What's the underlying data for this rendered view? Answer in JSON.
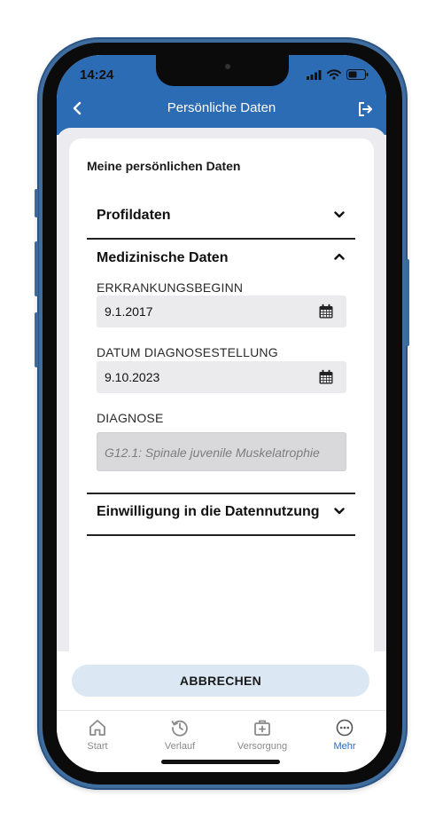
{
  "status_bar": {
    "time": "14:24"
  },
  "nav": {
    "title": "Persönliche Daten"
  },
  "card": {
    "title": "Meine persönlichen Daten"
  },
  "sections": {
    "profile": {
      "label": "Profildaten"
    },
    "medical": {
      "label": "Medizinische Daten",
      "onset_label": "ERKRANKUNGSBEGINN",
      "onset_value": "9.1.2017",
      "diagnosis_date_label": "DATUM DIAGNOSESTELLUNG",
      "diagnosis_date_value": "9.10.2023",
      "diagnosis_label": "DIAGNOSE",
      "diagnosis_value": "G12.1: Spinale juvenile Muskelatrophie"
    },
    "consent": {
      "label": "Einwilligung in die Datennutzung"
    }
  },
  "cancel_button": "ABBRECHEN",
  "tabs": [
    {
      "label": "Start",
      "icon": "home-icon"
    },
    {
      "label": "Verlauf",
      "icon": "history-icon"
    },
    {
      "label": "Versorgung",
      "icon": "medical-kit-icon"
    },
    {
      "label": "Mehr",
      "icon": "more-icon"
    }
  ],
  "colors": {
    "header_blue": "#2b6cb5",
    "button_bg": "#dbe8f4",
    "active_tab": "#2b6cb5",
    "phone_frame": "#3f6d9e"
  }
}
